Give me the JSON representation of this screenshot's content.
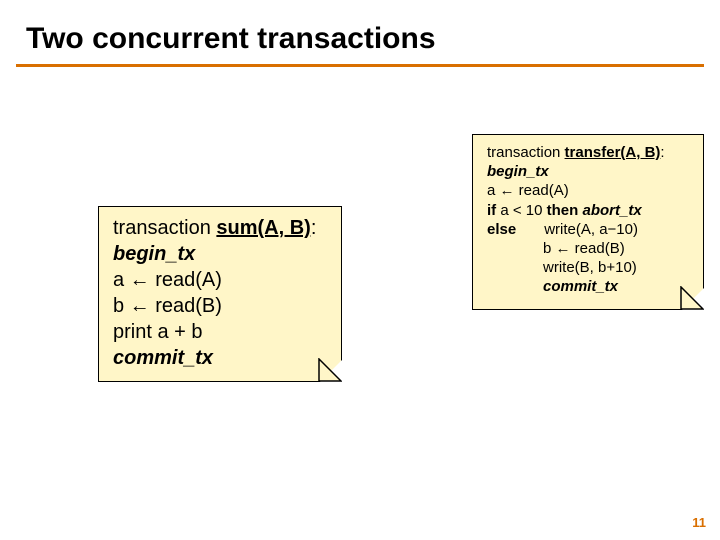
{
  "title": "Two concurrent transactions",
  "page_number": "11",
  "left_note": {
    "l1a": "transaction ",
    "l1b": "sum(A, B)",
    "l1c": ":",
    "l2": "begin_tx",
    "l3": "a ← read(A)",
    "l4": "b ← read(B)",
    "l5": "print a + b",
    "l6": "commit_tx"
  },
  "right_note": {
    "l1a": "transaction ",
    "l1b": "transfer(A, B)",
    "l1c": ":",
    "l2": "begin_tx",
    "l3": "a ← read(A)",
    "l4a": "if",
    "l4b": " a < 10 ",
    "l4c": "then ",
    "l4d": "abort_tx",
    "l5a": "else",
    "l5b": "write(A, a−10)",
    "l6": "b ← read(B)",
    "l7": "write(B, b+10)",
    "l8": "commit_tx"
  }
}
